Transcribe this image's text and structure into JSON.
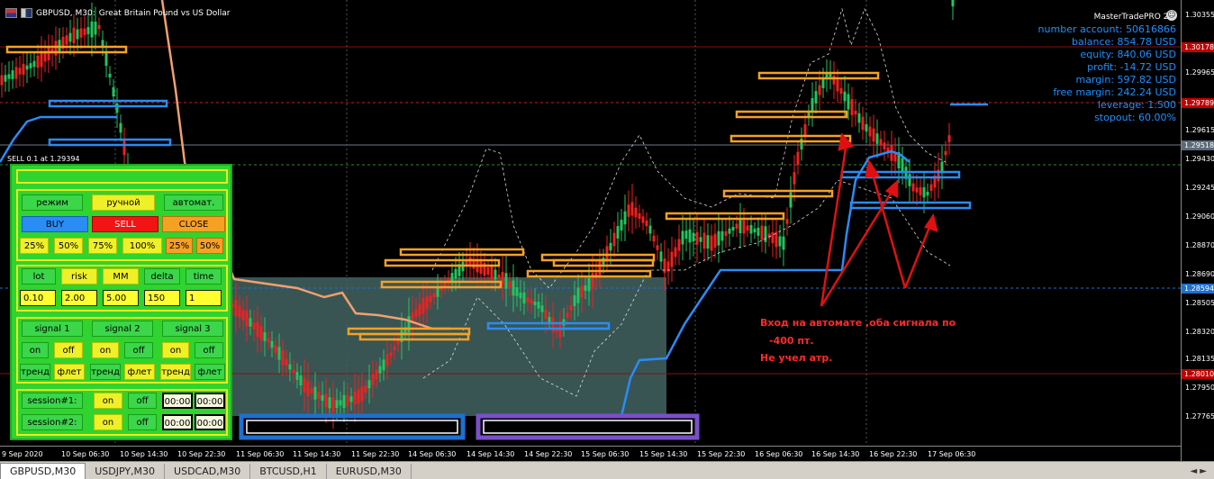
{
  "window": {
    "symbol_title": "GBPUSD, M30:",
    "description": "Great Britain Pound vs US Dollar"
  },
  "account": {
    "brand": "MasterTradePRO 2.0",
    "lines": [
      "number account: 50616866",
      "balance: 854.78 USD",
      "equity: 840.06 USD",
      "profit: -14.72 USD",
      "margin: 597.82 USD",
      "free margin: 242.24 USD",
      "leverage: 1:500",
      "stopout: 60.00%"
    ]
  },
  "price_axis": {
    "ticks": [
      "1.30355",
      "1.30175",
      "1.29965",
      "1.29785",
      "1.29615",
      "1.29430",
      "1.29245",
      "1.29060",
      "1.28870",
      "1.28690",
      "1.28505",
      "1.28320",
      "1.28135",
      "1.27950",
      "1.27765"
    ],
    "tags": [
      {
        "text": "1.30178",
        "color": "#c00000"
      },
      {
        "text": "1.29789",
        "color": "#c00000"
      },
      {
        "text": "1.29518",
        "color": "#5a6a7a"
      },
      {
        "text": "1.28594",
        "color": "#1e70d0"
      },
      {
        "text": "1.28010",
        "color": "#c00000"
      }
    ]
  },
  "time_axis": [
    "9 Sep 2020",
    "10 Sep 06:30",
    "10 Sep 14:30",
    "10 Sep 22:30",
    "11 Sep 06:30",
    "11 Sep 14:30",
    "11 Sep 22:30",
    "14 Sep 06:30",
    "14 Sep 14:30",
    "14 Sep 22:30",
    "15 Sep 06:30",
    "15 Sep 14:30",
    "15 Sep 22:30",
    "16 Sep 06:30",
    "16 Sep 14:30",
    "16 Sep 22:30",
    "17 Sep 06:30"
  ],
  "trade_label": "SELL 0.1 at 1.29394",
  "panel": {
    "mode_label": "режим",
    "manual_label": "ручной",
    "auto_label": "автомат.",
    "buy_label": "BUY",
    "sell_label": "SELL",
    "close_label": "CLOSE",
    "pct_left": [
      "25%",
      "50%",
      "75%",
      "100%"
    ],
    "pct_right": [
      "25%",
      "50%"
    ],
    "param_labels": [
      "lot",
      "risk",
      "MM",
      "delta",
      "time"
    ],
    "param_values": [
      "0.10",
      "2.00",
      "5.00",
      "150",
      "1"
    ],
    "signal_labels": [
      "signal 1",
      "signal 2",
      "signal 3"
    ],
    "on_label": "on",
    "off_label": "off",
    "trend_label": "тренд",
    "flat_label": "флет",
    "session1_label": "session#1:",
    "session2_label": "session#2:",
    "session_times": [
      "00:00",
      "00:00",
      "00:00",
      "00:00"
    ]
  },
  "annotation": {
    "line1": "Вход на автомате ,оба сигнала по",
    "line2": "-400 пт.",
    "line3": "Не учел атр."
  },
  "tabs": [
    "GBPUSD,M30",
    "USDJPY,M30",
    "USDCAD,M30",
    "BTCUSD,H1",
    "EURUSD,M30"
  ],
  "tab_nav": "◄ ►"
}
